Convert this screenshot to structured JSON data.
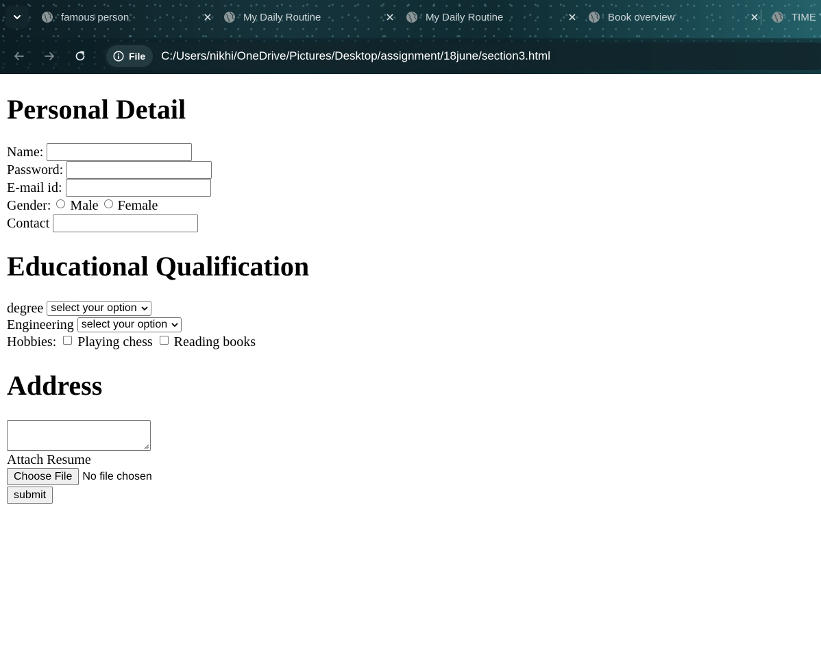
{
  "browser": {
    "tabs": [
      {
        "title": "famous person"
      },
      {
        "title": "My Daily Routine"
      },
      {
        "title": "My Daily Routine"
      },
      {
        "title": "Book overview"
      },
      {
        "title": "TIME T"
      }
    ],
    "address_chip": "File",
    "url": "C:/Users/nikhi/OneDrive/Pictures/Desktop/assignment/18june/section3.html"
  },
  "personal": {
    "heading": "Personal Detail",
    "name_label": "Name:",
    "password_label": "Password:",
    "email_label": "E-mail id:",
    "gender_label": "Gender:",
    "male_label": "Male",
    "female_label": "Female",
    "contact_label": "Contact"
  },
  "education": {
    "heading": "Educational Qualification",
    "degree_label": "degree",
    "degree_selected": "select your option",
    "engineering_label": "Engineering",
    "engineering_selected": "select your option",
    "hobbies_label": "Hobbies:",
    "hobby_1": "Playing chess",
    "hobby_2": "Reading books"
  },
  "address": {
    "heading": "Address",
    "attach_label": "Attach Resume",
    "choose_file_label": "Choose File",
    "file_status": "No file chosen",
    "submit_label": "submit"
  }
}
